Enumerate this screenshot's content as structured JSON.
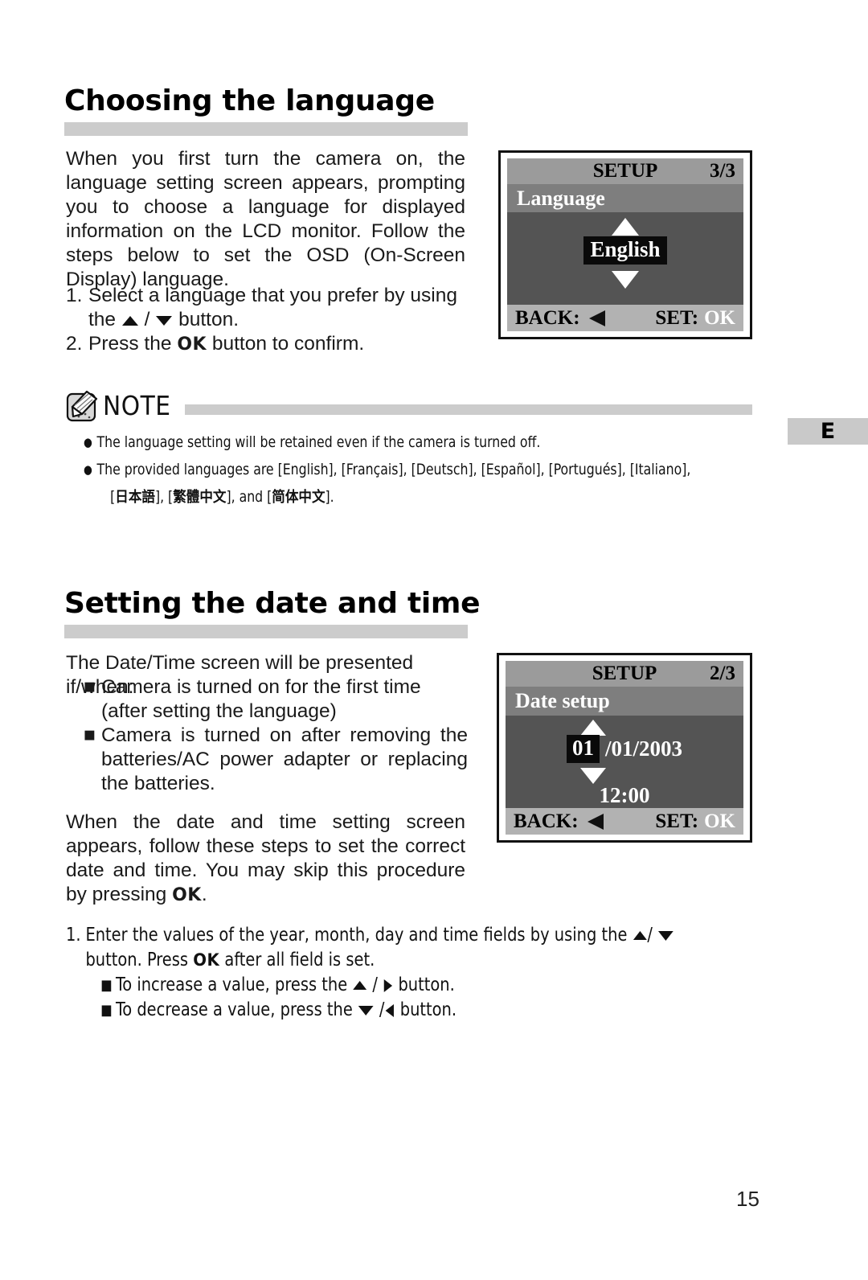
{
  "page": {
    "number": "15",
    "edition_tab": "E"
  },
  "section1": {
    "heading": "Choosing the language",
    "intro": "When you first turn the camera on, the language setting screen appears, prompting you to choose a language for displayed information on the LCD monitor. Follow the steps below to set the OSD (On-Screen Display) language.",
    "steps": [
      {
        "num": "1.",
        "pre": "Select a language that you prefer by using the ",
        "mid": " / ",
        "post": " button.",
        "icons": [
          "up-triangle-icon",
          "down-triangle-icon"
        ]
      },
      {
        "num": "2.",
        "pre": "Press the ",
        "kbd": "OK",
        "post": " button to confirm."
      }
    ]
  },
  "lcd1": {
    "header_title": "SETUP",
    "header_page": "3/3",
    "subtitle": "Language",
    "value": "English",
    "up_icon": "up-triangle-icon",
    "down_icon": "down-triangle-icon",
    "back_label": "BACK:",
    "back_icon": "left-triangle-icon",
    "set_label": "SET:",
    "set_value": "OK"
  },
  "note": {
    "title": "NOTE",
    "icon": "note-pad-pencil-icon",
    "bullets": [
      {
        "parts": [
          "The language setting will be retained even if the camera is turned off."
        ]
      },
      {
        "line1": "The provided languages are [English], [Français], [Deutsch], [Español], [Portugués], [Italiano],",
        "line2_pre": "[",
        "line2_jp": "日本語",
        "line2_mid1": "], [",
        "line2_tc": "繁體中文",
        "line2_mid2": "], and [",
        "line2_sc": "简体中文",
        "line2_post": "]."
      }
    ]
  },
  "section2": {
    "heading": "Setting the date and time",
    "lead": "The Date/Time screen will be presented if/when:",
    "bullets": [
      "Camera is turned on for the first time (after setting the language)",
      "Camera is turned on after removing the batteries/AC power adapter or replacing the batteries."
    ],
    "para_pre": "When the date and time setting screen appears, follow these steps to set the correct date and time. You may skip this procedure by pressing ",
    "para_kbd": "OK",
    "para_post": "."
  },
  "lcd2": {
    "header_title": "SETUP",
    "header_page": "2/3",
    "subtitle": "Date setup",
    "day_highlight": "01",
    "date_rest": "/01/2003",
    "time": "12:00",
    "up_icon": "up-triangle-icon",
    "down_icon": "down-triangle-icon",
    "back_label": "BACK:",
    "back_icon": "left-triangle-icon",
    "set_label": "SET:",
    "set_value": "OK"
  },
  "section3": {
    "step_num": "1.",
    "step_pre": "Enter the values of the year, month, day and time fields by using the ",
    "step_mid": "/ ",
    "step_line2_pre": "button. Press ",
    "step_kbd": "OK",
    "step_line2_post": " after all field is set.",
    "subs": [
      {
        "pre": "To increase a value, press the ",
        "mid": " / ",
        "post": " button.",
        "icons": [
          "up-triangle-icon",
          "right-triangle-icon"
        ]
      },
      {
        "pre": "To decrease a value, press the ",
        "mid": " /",
        "post": " button.",
        "icons": [
          "down-triangle-icon",
          "left-triangle-icon"
        ]
      }
    ]
  }
}
